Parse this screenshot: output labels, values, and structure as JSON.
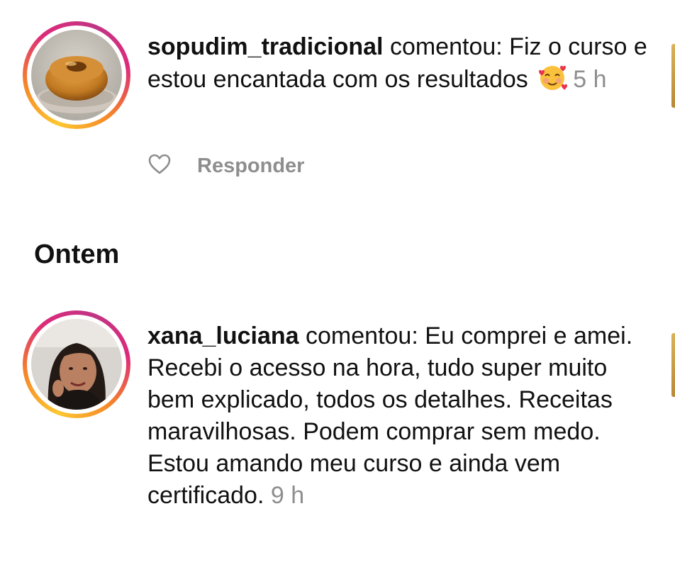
{
  "notifications": [
    {
      "username": "sopudim_tradicional",
      "verb": "comentou:",
      "comment": "Fiz o curso e estou encantada com os resultados",
      "emoji": "smiling-face-with-hearts",
      "time": "5 h",
      "reply_label": "Responder"
    },
    {
      "username": "xana_luciana",
      "verb": "comentou:",
      "comment": "Eu comprei e amei. Recebi o acesso na hora, tudo super muito bem explicado,  todos os detalhes.  Receitas maravilhosas. Podem comprar sem medo. Estou amando meu curso e ainda vem certificado.",
      "time": "9 h"
    }
  ],
  "section": {
    "title": "Ontem"
  },
  "colors": {
    "text": "#111111",
    "muted": "#8e8e8e",
    "ring_start": "#fdc830",
    "ring_end": "#dd2a7b"
  }
}
